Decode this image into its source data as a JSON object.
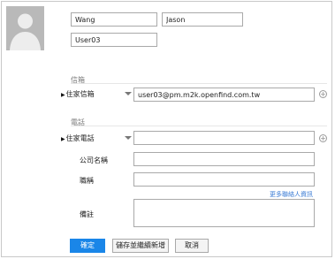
{
  "profile": {
    "last_name": "Wang",
    "first_name": "Jason",
    "display_name": "User03"
  },
  "email_section": {
    "title": "信箱",
    "type_label": "住家信箱",
    "value": "user03@pm.m2k.openfind.com.tw"
  },
  "phone_section": {
    "title": "電話",
    "type_label": "住家電話",
    "value": ""
  },
  "fields": {
    "company_label": "公司名稱",
    "company_value": "",
    "jobtitle_label": "職稱",
    "jobtitle_value": "",
    "more_info_link": "更多聯絡人資訊",
    "note_label": "備註",
    "note_value": ""
  },
  "buttons": {
    "confirm": "確定",
    "save_and_new": "儲存並繼續新增",
    "cancel": "取消"
  },
  "icons": {
    "avatar": "avatar-placeholder",
    "expand": "play-triangle",
    "dropdown": "chevron-down",
    "add": "plus-circle"
  },
  "colors": {
    "primary_button": "#1a86e8",
    "link": "#3a7bd5"
  }
}
